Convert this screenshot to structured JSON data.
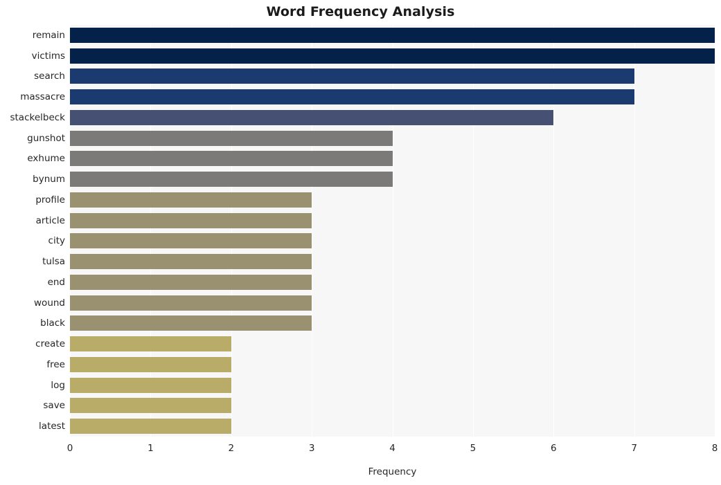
{
  "chart_data": {
    "type": "bar",
    "orientation": "horizontal",
    "title": "Word Frequency Analysis",
    "xlabel": "Frequency",
    "ylabel": "",
    "categories": [
      "remain",
      "victims",
      "search",
      "massacre",
      "stackelbeck",
      "gunshot",
      "exhume",
      "bynum",
      "profile",
      "article",
      "city",
      "tulsa",
      "end",
      "wound",
      "black",
      "create",
      "free",
      "log",
      "save",
      "latest"
    ],
    "values": [
      8,
      8,
      7,
      7,
      6,
      4,
      4,
      4,
      3,
      3,
      3,
      3,
      3,
      3,
      3,
      2,
      2,
      2,
      2,
      2
    ],
    "bar_colors": [
      "#042249",
      "#042249",
      "#1b3a70",
      "#1b3a70",
      "#465073",
      "#7b7a78",
      "#7b7a78",
      "#7b7a78",
      "#99916f",
      "#99916f",
      "#99916f",
      "#99916f",
      "#99916f",
      "#99916f",
      "#99916f",
      "#b9ac68",
      "#b9ac68",
      "#b9ac68",
      "#b9ac68",
      "#b9ac68"
    ],
    "xlim": [
      0,
      8
    ],
    "x_ticks": [
      "0",
      "1",
      "2",
      "3",
      "4",
      "5",
      "6",
      "7",
      "8"
    ],
    "x_tick_values": [
      0,
      1,
      2,
      3,
      4,
      5,
      6,
      7,
      8
    ],
    "grid": true,
    "grid_axis": "x",
    "grid_color": "#ffffff",
    "plot_background": "#f7f7f7",
    "figure_background": "#ffffff",
    "legend": null
  }
}
